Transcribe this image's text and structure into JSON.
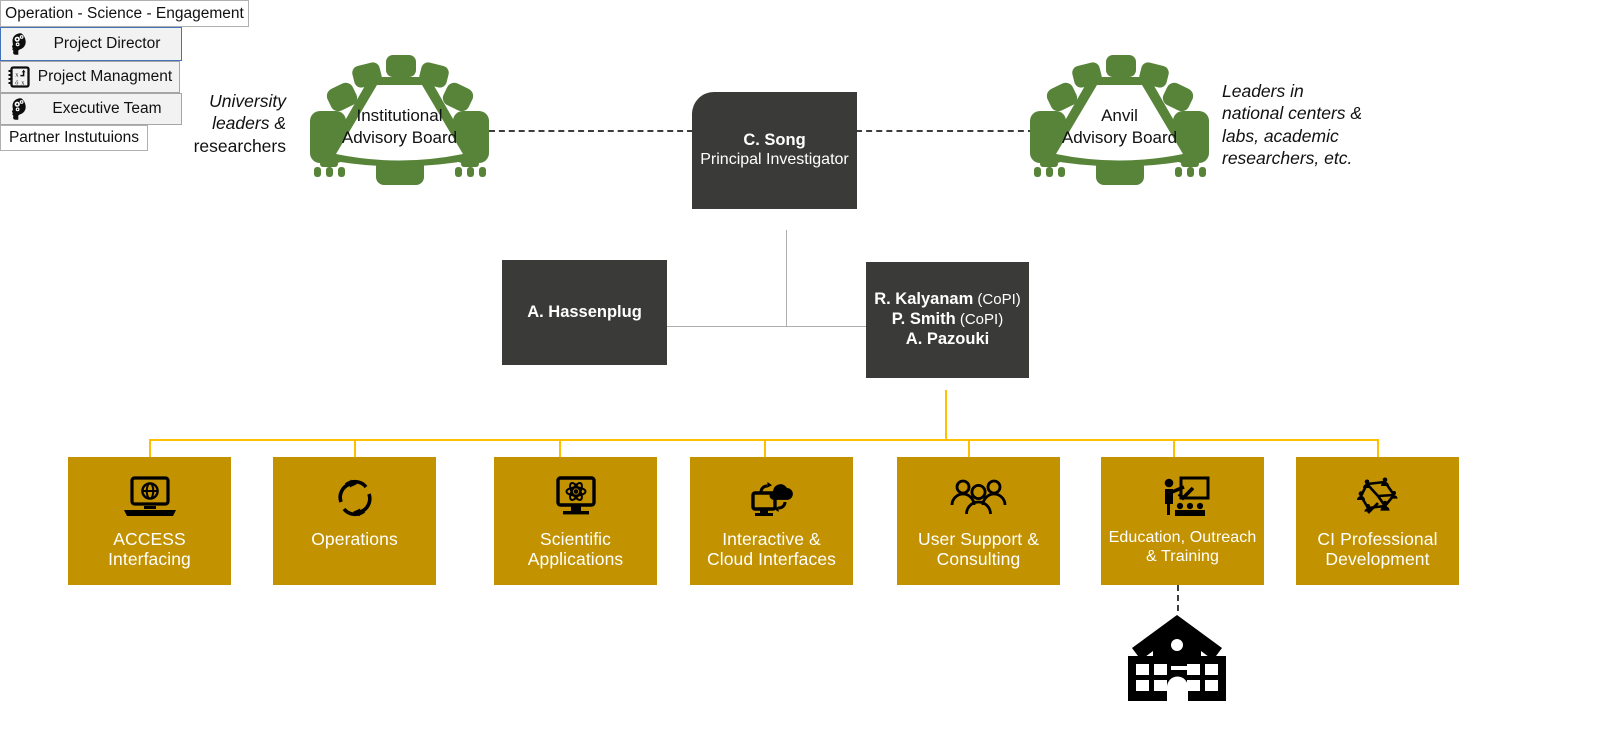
{
  "diagram": {
    "title": "Anvil Project Organizational Chart",
    "colors": {
      "dark_box": "#3a3a38",
      "gold_box": "#c29200",
      "gold_connector": "#ffc000",
      "board_green": "#58843a",
      "grey_connector": "#aeaeae",
      "badge_border_blue": "#4472b8"
    }
  },
  "advisory_boards": {
    "left": {
      "icon": "boardroom-table-icon",
      "line1": "Institutional",
      "line2": "Advisory Board",
      "caption_line1": "University",
      "caption_line2": "leaders &",
      "caption_line3": "researchers"
    },
    "right": {
      "icon": "boardroom-table-icon",
      "line1": "Anvil",
      "line2": "Advisory Board",
      "tag": "Operation - Science - Engagement",
      "caption_line1": "Leaders in",
      "caption_line2": "national centers &",
      "caption_line3": "labs, academic",
      "caption_line4": "researchers, etc."
    }
  },
  "leadership": {
    "pi": {
      "name": "C. Song",
      "role": "Principal Investigator",
      "badge": {
        "label": "Project Director",
        "icon": "head-with-gears-icon"
      }
    },
    "project_management": {
      "name": "A. Hassenplug",
      "badge": {
        "label": "Project Managment",
        "icon": "project-plan-icon"
      }
    },
    "executive": {
      "people": [
        {
          "name": "R. Kalyanam",
          "suffix": " (CoPI)"
        },
        {
          "name": "P. Smith",
          "suffix": " (CoPI)"
        },
        {
          "name": "A. Pazouki",
          "suffix": ""
        }
      ],
      "badge": {
        "label": "Executive Team",
        "icon": "head-with-gears-icon"
      }
    }
  },
  "work_areas": [
    {
      "label_line1": "ACCESS",
      "label_line2": "Interfacing",
      "icon": "laptop-globe-icon"
    },
    {
      "label_line1": "Operations",
      "label_line2": "",
      "icon": "refresh-cycle-icon"
    },
    {
      "label_line1": "Scientific",
      "label_line2": "Applications",
      "icon": "monitor-atom-icon"
    },
    {
      "label_line1": "Interactive &",
      "label_line2": "Cloud Interfaces",
      "icon": "cloud-monitor-icon"
    },
    {
      "label_line1": "User Support &",
      "label_line2": "Consulting",
      "icon": "people-group-icon"
    },
    {
      "label_line1": "Education, Outreach",
      "label_line2": "& Training",
      "icon": "presenter-board-icon"
    },
    {
      "label_line1": "CI Professional",
      "label_line2": "Development",
      "icon": "network-people-icon"
    }
  ],
  "partners": {
    "icon": "institution-building-icon",
    "label": "Partner Instutuions"
  }
}
